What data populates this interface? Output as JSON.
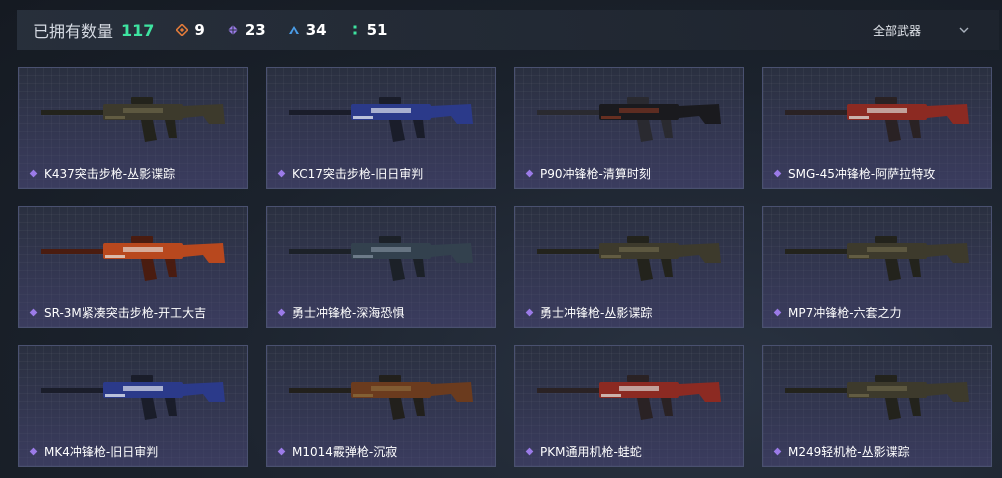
{
  "header": {
    "owned_label": "已拥有数量",
    "owned_count": "117",
    "stats": [
      {
        "icon": "orange-rarity-icon",
        "value": "9",
        "color": "#e07a3a"
      },
      {
        "icon": "purple-rarity-icon",
        "value": "23",
        "color": "#9b7be8"
      },
      {
        "icon": "blue-rarity-icon",
        "value": "34",
        "color": "#4a9ee8"
      },
      {
        "icon": "green-rarity-icon",
        "value": "51",
        "color": "#3ee3a0"
      }
    ],
    "filter": {
      "selected": "全部武器"
    }
  },
  "weapons": [
    {
      "name": "K437突击步枪-丛影谍踪",
      "palette": "camo"
    },
    {
      "name": "KC17突击步枪-旧日审判",
      "palette": "bluewhite"
    },
    {
      "name": "P90冲锋枪-清算时刻",
      "palette": "blackred"
    },
    {
      "name": "SMG-45冲锋枪-阿萨拉特攻",
      "palette": "redwhite"
    },
    {
      "name": "SR-3M紧凑突击步枪-开工大吉",
      "palette": "orange"
    },
    {
      "name": "勇士冲锋枪-深海恐惧",
      "palette": "bluegrey"
    },
    {
      "name": "勇士冲锋枪-丛影谍踪",
      "palette": "camo"
    },
    {
      "name": "MP7冲锋枪-六套之力",
      "palette": "camo"
    },
    {
      "name": "MK4冲锋枪-旧日审判",
      "palette": "bluewhite"
    },
    {
      "name": "M1014霰弹枪-沉寂",
      "palette": "wood"
    },
    {
      "name": "PKM通用机枪-蛙蛇",
      "palette": "redwhite"
    },
    {
      "name": "M249轻机枪-丛影谍踪",
      "palette": "camo"
    }
  ],
  "colors": {
    "accent_green": "#3ee3a0",
    "rarity_purple": "#9b7be8"
  }
}
